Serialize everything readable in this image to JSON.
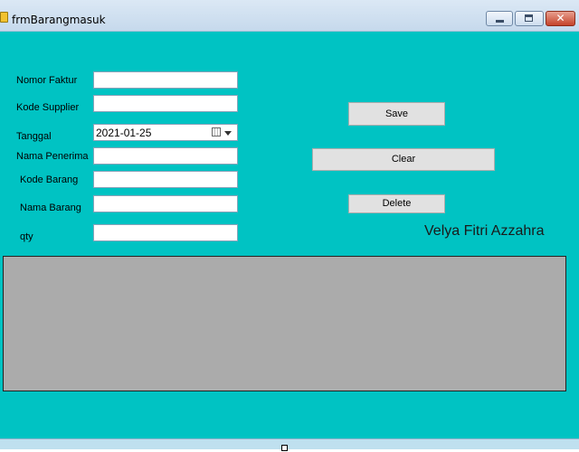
{
  "window": {
    "title": "frmBarangmasuk",
    "close_glyph": "✕"
  },
  "labels": {
    "nomor_faktur": "Nomor Faktur",
    "kode_supplier": "Kode Supplier",
    "tanggal": "Tanggal",
    "nama_penerima": "Nama Penerima",
    "kode_barang": "Kode Barang",
    "nama_barang": "Nama Barang",
    "qty": "qty"
  },
  "fields": {
    "nomor_faktur": "",
    "kode_supplier": "",
    "tanggal": "2021-01-25",
    "nama_penerima": "",
    "kode_barang": "",
    "nama_barang": "",
    "qty": ""
  },
  "buttons": {
    "save": "Save",
    "clear": "Clear",
    "delete": "Delete"
  },
  "author_label": "Velya Fitri Azzahra",
  "colors": {
    "form_background": "#00c3c3",
    "grid_background": "#ababab",
    "button_face": "#e1e1e1"
  }
}
